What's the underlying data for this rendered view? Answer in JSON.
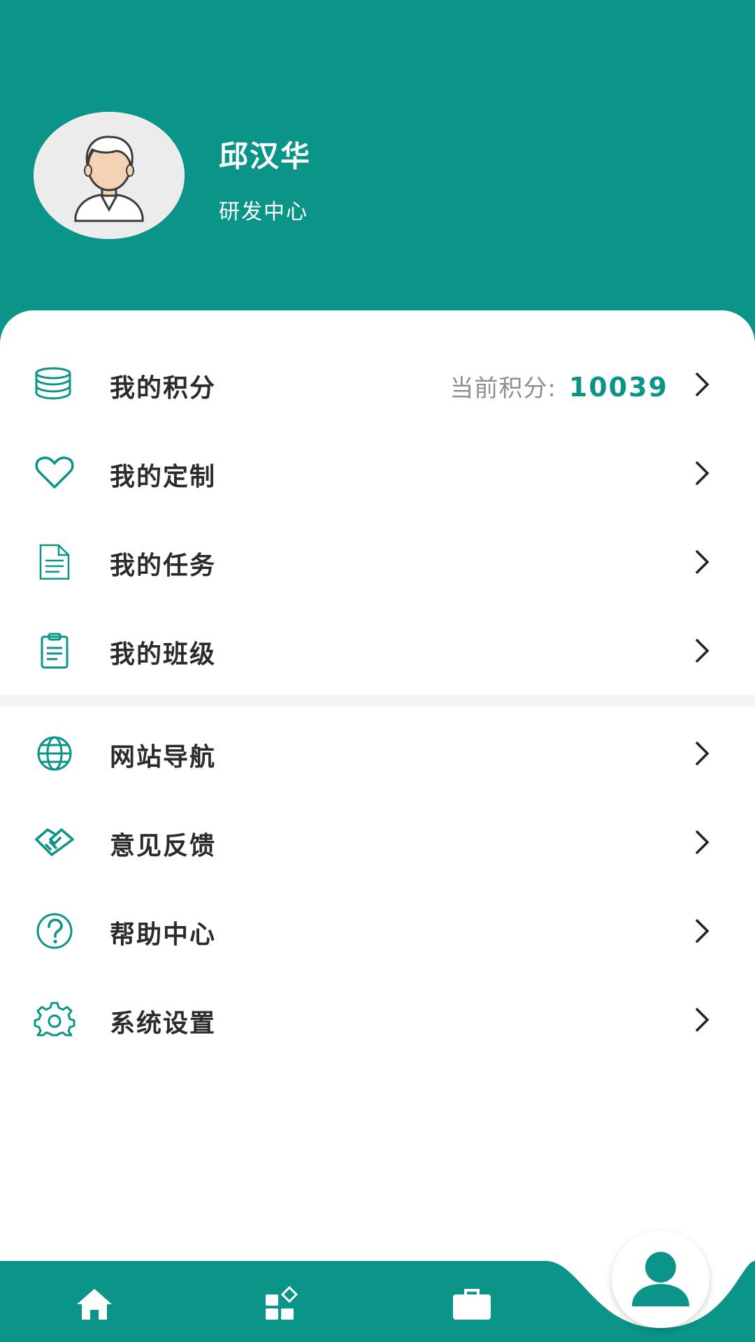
{
  "profile": {
    "name": "邱汉华",
    "department": "研发中心"
  },
  "menu_primary": [
    {
      "label": "我的积分",
      "icon": "coins-stack-icon",
      "points_label": "当前积分:",
      "points_value": "10039"
    },
    {
      "label": "我的定制",
      "icon": "heart-icon"
    },
    {
      "label": "我的任务",
      "icon": "document-icon"
    },
    {
      "label": "我的班级",
      "icon": "clipboard-icon"
    }
  ],
  "menu_secondary": [
    {
      "label": "网站导航",
      "icon": "globe-icon"
    },
    {
      "label": "意见反馈",
      "icon": "handshake-icon"
    },
    {
      "label": "帮助中心",
      "icon": "question-circle-icon"
    },
    {
      "label": "系统设置",
      "icon": "gear-icon"
    }
  ],
  "tabbar": {
    "tabs": [
      "home-icon",
      "apps-icon",
      "briefcase-icon"
    ],
    "active": "user-icon"
  },
  "colors": {
    "primary": "#0b9488",
    "text": "#2b2b2b",
    "muted": "#8f8f8f"
  }
}
